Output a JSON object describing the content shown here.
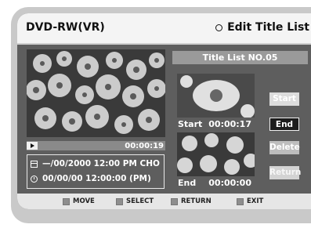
{
  "header": {
    "device": "DVD-RW(VR)",
    "menu_title": "Edit Title List"
  },
  "preview": {
    "elapsed": "00:00:19"
  },
  "info": {
    "date_line": "—/00/2000 12:00 PM CHO",
    "time_line": "00/00/00 12:00:00 (PM)"
  },
  "title_list": {
    "label": "Title List NO.05"
  },
  "start_marker": {
    "label": "Start",
    "time": "00:00:17"
  },
  "end_marker": {
    "label": "End",
    "time": "00:00:00"
  },
  "buttons": {
    "start": "Start",
    "end": "End",
    "delete": "Delete",
    "return": "Return"
  },
  "footer": {
    "move": "MOVE",
    "select": "SELECT",
    "return": "RETURN",
    "exit": "EXIT"
  }
}
